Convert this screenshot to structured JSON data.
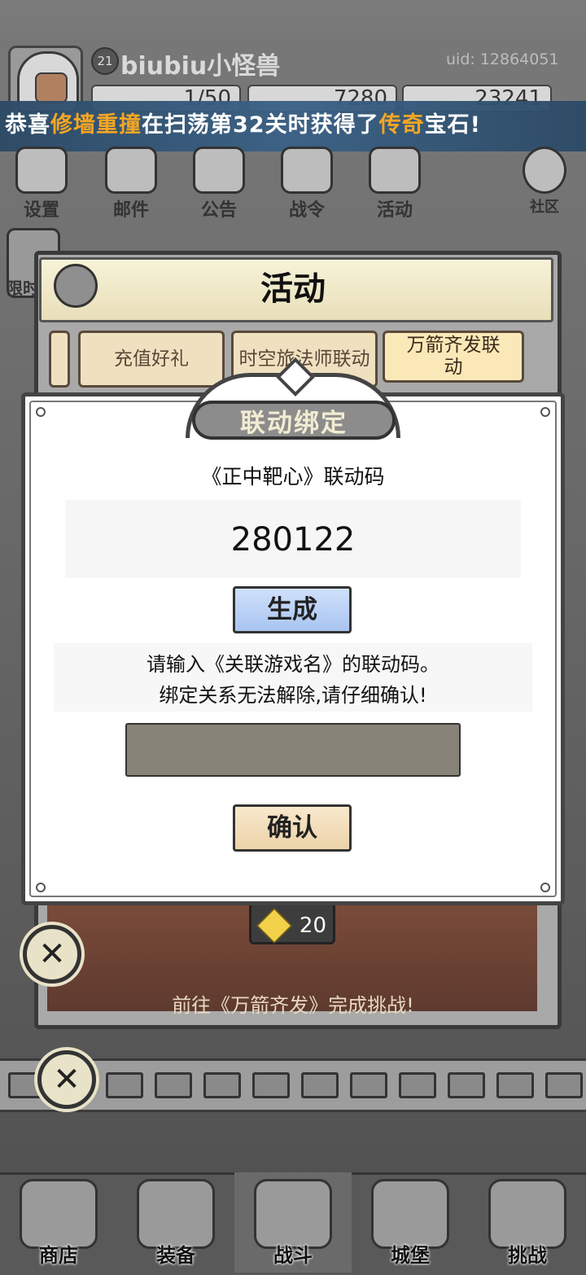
{
  "player": {
    "level": "21",
    "name": "biubiu小怪兽",
    "uid": "uid: 12864051",
    "energy": "1/50",
    "diamonds": "7280",
    "gold": "23241"
  },
  "banner": {
    "prefix": "恭喜",
    "player": "修墙重撞",
    "middle": "在扫荡第32关时获得了",
    "item": "传奇",
    "suffix": "宝石!"
  },
  "top_menu": [
    "设置",
    "邮件",
    "公告",
    "战令",
    "活动",
    "社区"
  ],
  "side_label": "限时",
  "activity_panel": {
    "title": "活动",
    "tabs": [
      "充值好礼",
      "时空旅法师联动",
      "万箭齐发联动"
    ],
    "reward_count": "20",
    "footer_text": "前往《万箭齐发》完成挑战!"
  },
  "dialog": {
    "title": "联动绑定",
    "code_label": "《正中靶心》联动码",
    "code_value": "280122",
    "generate_button": "生成",
    "hint_line1": "请输入《关联游戏名》的联动码。",
    "hint_line2": "绑定关系无法解除,请仔细确认!",
    "input_value": "",
    "confirm_button": "确认"
  },
  "close_icons": [
    "close-icon",
    "close-icon"
  ],
  "bottom_nav": [
    "商店",
    "装备",
    "战斗",
    "城堡",
    "挑战"
  ],
  "colors": {
    "banner_bg": "#3a6186",
    "banner_highlight": "#f5a623",
    "generate_button": "#a9c4f0",
    "confirm_button": "#ecd3a8",
    "input_bg": "#878378"
  }
}
